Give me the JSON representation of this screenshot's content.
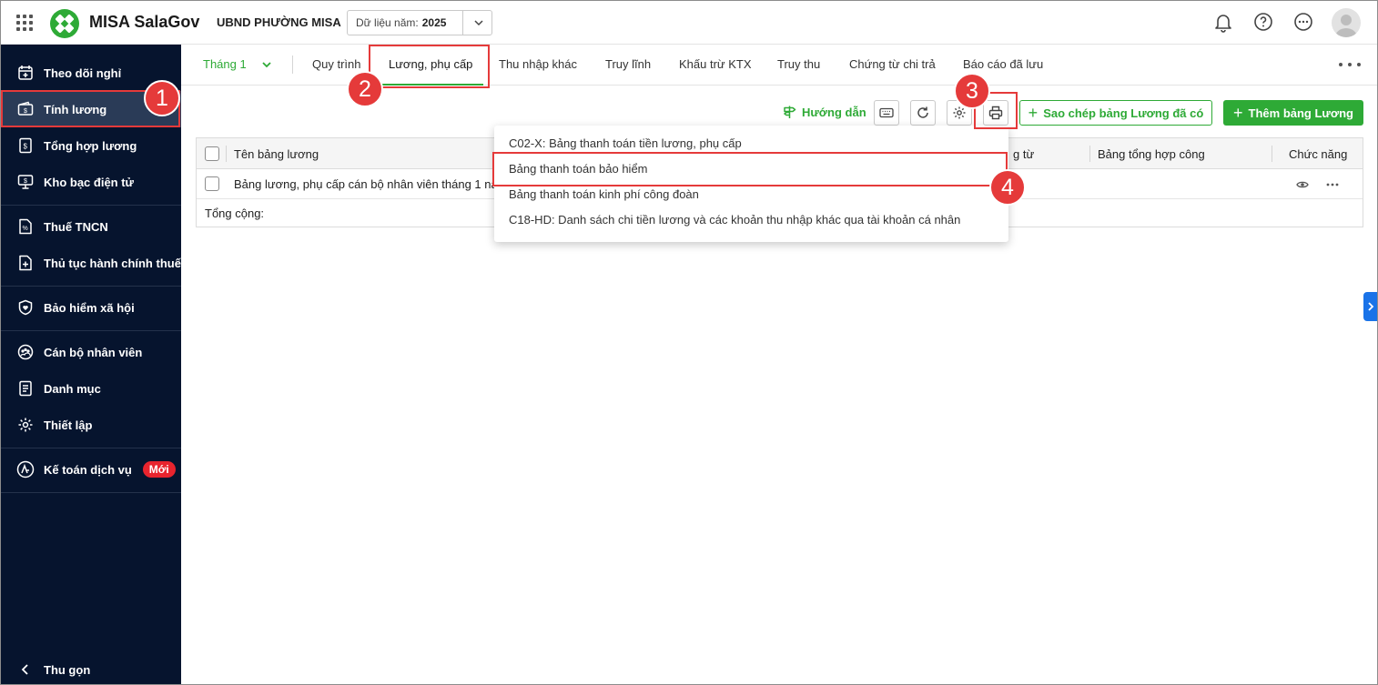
{
  "header": {
    "app_name": "MISA SalaGov",
    "org_name": "UBND PHƯỜNG MISA",
    "year_label": "Dữ liệu năm:",
    "year_value": "2025"
  },
  "sidebar": {
    "items": [
      {
        "label": "Theo dõi nghỉ",
        "icon": "calendar-icon"
      },
      {
        "label": "Tính lương",
        "icon": "wallet-icon"
      },
      {
        "label": "Tổng hợp lương",
        "icon": "money-doc-icon"
      },
      {
        "label": "Kho bạc điện tử",
        "icon": "monitor-icon"
      },
      {
        "label": "Thuế TNCN",
        "icon": "tax-doc-icon"
      },
      {
        "label": "Thủ tục hành chính thuế",
        "icon": "doc-plus-icon"
      },
      {
        "label": "Bảo hiểm xã hội",
        "icon": "shield-heart-icon"
      },
      {
        "label": "Cán bộ nhân viên",
        "icon": "people-icon"
      },
      {
        "label": "Danh mục",
        "icon": "list-doc-icon"
      },
      {
        "label": "Thiết lập",
        "icon": "gear-icon"
      },
      {
        "label": "Kế toán dịch vụ",
        "icon": "accounting-icon",
        "badge": "Mới"
      }
    ],
    "collapse_label": "Thu gọn"
  },
  "tabs": {
    "month": "Tháng 1",
    "items": [
      "Quy trình",
      "Lương, phụ cấp",
      "Thu nhập khác",
      "Truy lĩnh",
      "Khấu trừ KTX",
      "Truy thu",
      "Chứng từ chi trả",
      "Báo cáo đã lưu"
    ],
    "active": "Lương, phụ cấp"
  },
  "toolbar": {
    "guide_label": "Hướng dẫn",
    "copy_label": "Sao chép bảng Lương đã có",
    "add_label": "Thêm bảng Lương"
  },
  "table": {
    "headers": {
      "name": "Tên bảng lương",
      "doc": "g từ",
      "attendance": "Bảng tổng hợp công",
      "actions": "Chức năng"
    },
    "rows": [
      {
        "name": "Bảng lương, phụ cấp cán bộ nhân viên tháng 1 năm"
      }
    ],
    "total_label": "Tổng cộng:"
  },
  "print_menu": {
    "items": [
      "C02-X: Bảng thanh toán tiền lương, phụ cấp",
      "Bảng thanh toán bảo hiểm",
      "Bảng thanh toán kinh phí công đoàn",
      "C18-HD: Danh sách chi tiền lương và các khoản thu nhập khác qua tài khoản cá nhân"
    ]
  },
  "callouts": [
    "1",
    "2",
    "3",
    "4"
  ],
  "colors": {
    "brand_green": "#2eaa36",
    "sidebar_bg": "#06142e",
    "highlight_red": "#e53a3a"
  }
}
